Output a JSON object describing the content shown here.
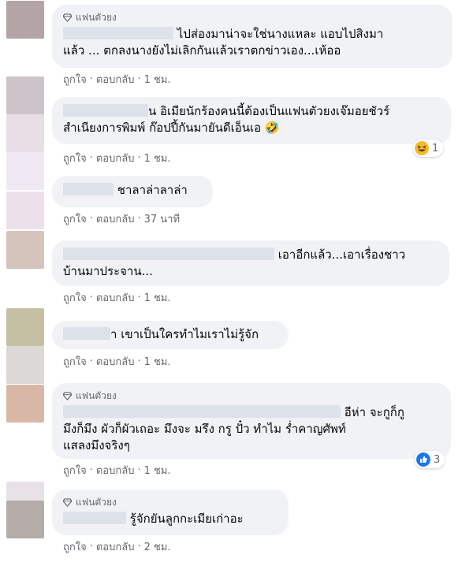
{
  "labels": {
    "like": "ถูกใจ",
    "reply": "ตอบกลับ",
    "separator": "·",
    "fan_badge": "แฟนตัวยง"
  },
  "colors": {
    "avatar": [
      "#b3a4a6",
      "#ccc4c9",
      "#e8dee6",
      "#f0e8f2",
      "#d4c4bc",
      "#c5c0a4",
      "#dcd8d6",
      "#d9b7a6",
      "#e8e2e8",
      "#b4aca8"
    ]
  },
  "comments": [
    {
      "fan": true,
      "lines": [
        "ไปส่องมาน่าจะใช่นางแหละ แอบไปสิงมา",
        "แล้ว ... ตกลงนางยังไม่เลิกกันแล้วเราตกข่าวเอง...เห้ออ"
      ],
      "time": "1 ชม."
    },
    {
      "fan": false,
      "lines": [
        "น อิเมียนักร้องคนนี้ต้องเป็นแฟนตัวยงเจ๊มอยชัวร์",
        "สำเนียงการพิมพ์ ก๊อปปี้กันมายันดีเอ็นเอ 🤣"
      ],
      "time": "1 ชม.",
      "reaction": {
        "icon": "haha-reaction-icon",
        "count": "1"
      }
    },
    {
      "fan": false,
      "lines": [
        "ชาลาล่าลาล่า"
      ],
      "time": "37 นาที"
    },
    {
      "fan": false,
      "lines": [
        "เอาอีกแล้ว...เอาเรื่องชาว",
        "บ้านมาประจาน..."
      ],
      "time": "1 ชม."
    },
    {
      "fan": false,
      "lines": [
        "า เขาเป็นใครทำไมเราไม่รู้จัก"
      ],
      "time": "1 ชม."
    },
    {
      "fan": true,
      "lines": [
        "อีห่า จะกูก็กู",
        "มึงก็มึง ผัวก็ผัวเถอะ มึงจะ มรึง กรู ปั๋ว ทำไม ร่ำคาญศัพท์",
        "แสลงมึงจริงๆ"
      ],
      "time": "1 ชม.",
      "reaction": {
        "icon": "like-reaction-icon",
        "count": "3"
      }
    },
    {
      "fan": true,
      "lines": [
        "รู้จักยันลูกกะเมียเก่าอะ"
      ],
      "time": "2 ชม."
    }
  ]
}
